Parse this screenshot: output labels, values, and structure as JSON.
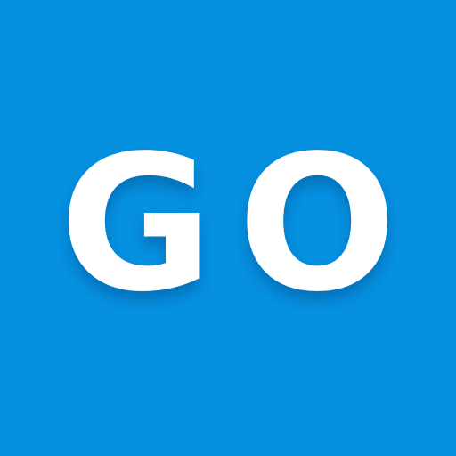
{
  "app_icon": {
    "label": "GO",
    "background_color": "#0690E0",
    "text_color": "#FFFFFF"
  }
}
